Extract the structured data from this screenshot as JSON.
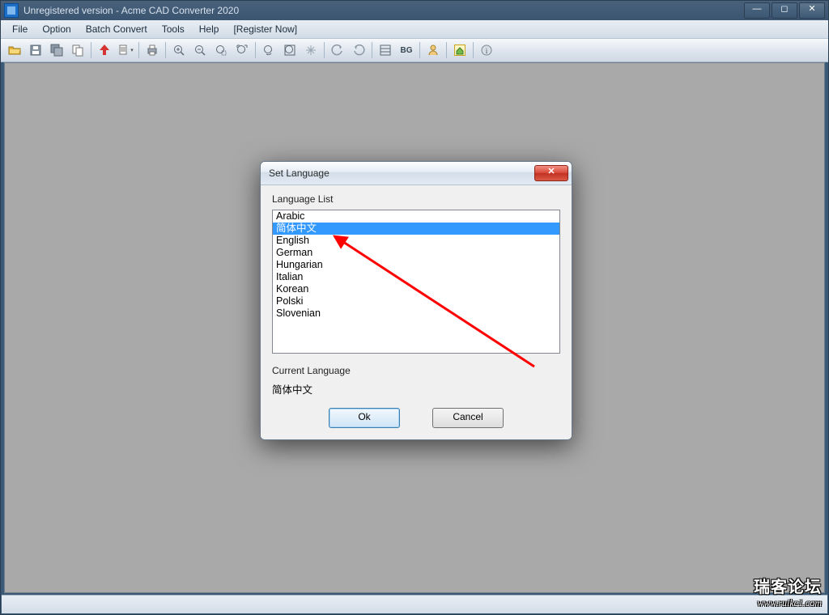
{
  "titlebar": {
    "title": "Unregistered version - Acme CAD Converter 2020"
  },
  "menu": {
    "items": [
      "File",
      "Option",
      "Batch Convert",
      "Tools",
      "Help",
      "[Register Now]"
    ]
  },
  "toolbar": {
    "BG_label": "BG"
  },
  "dialog": {
    "title": "Set Language",
    "list_label": "Language List",
    "languages": [
      "Arabic",
      "简体中文",
      "English",
      "German",
      "Hungarian",
      "Italian",
      "Korean",
      "Polski",
      "Slovenian"
    ],
    "selected_index": 1,
    "current_label": "Current Language",
    "current_value": "简体中文",
    "ok_label": "Ok",
    "cancel_label": "Cancel"
  },
  "watermark": {
    "line1": "瑞客论坛",
    "line2": "www.ruike1.com"
  }
}
